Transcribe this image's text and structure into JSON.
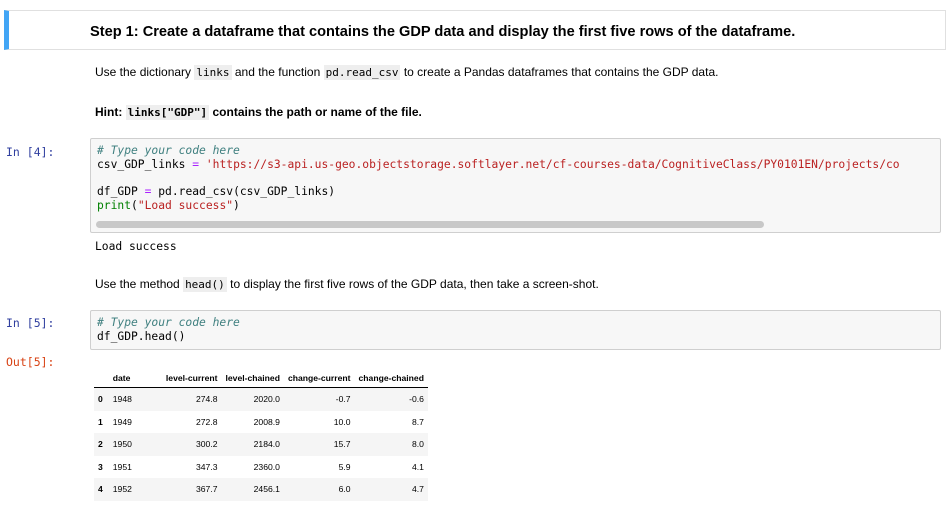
{
  "step": {
    "title": "Step 1: Create a dataframe that contains the GDP data and display the first five rows of the dataframe."
  },
  "instruction1": {
    "before": "Use the dictionary",
    "code1": "links",
    "mid": "and the function",
    "code2": "pd.read_csv",
    "after": "to create a Pandas dataframes that contains the GDP data."
  },
  "hint": {
    "label": "Hint:",
    "code": "links[\"GDP\"]",
    "after": "contains the path or name of the file."
  },
  "cell4": {
    "prompt": "In [4]:",
    "comment": "# Type your code here",
    "line1_var": "csv_GDP_links",
    "line1_op": "=",
    "line1_str": "'https://s3-api.us-geo.objectstorage.softlayer.net/cf-courses-data/CognitiveClass/PY0101EN/projects/co",
    "line2_a": "df_GDP",
    "line2_op": "=",
    "line2_b": "pd.read_csv(csv_GDP_links)",
    "line3_kw": "print",
    "line3_open": "(",
    "line3_str": "\"Load success\"",
    "line3_close": ")",
    "output": "Load success"
  },
  "instruction2": {
    "before": "Use the method",
    "code": "head()",
    "after": "to display the first five rows of the GDP data, then take a screen-shot."
  },
  "cell5": {
    "prompt": "In [5]:",
    "comment": "# Type your code here",
    "line1": "df_GDP.head()",
    "out_prompt": "Out[5]:"
  },
  "table": {
    "columns": [
      "",
      "date",
      "level-current",
      "level-chained",
      "change-current",
      "change-chained"
    ],
    "rows": [
      [
        "0",
        "1948",
        "274.8",
        "2020.0",
        "-0.7",
        "-0.6"
      ],
      [
        "1",
        "1949",
        "272.8",
        "2008.9",
        "10.0",
        "8.7"
      ],
      [
        "2",
        "1950",
        "300.2",
        "2184.0",
        "15.7",
        "8.0"
      ],
      [
        "3",
        "1951",
        "347.3",
        "2360.0",
        "5.9",
        "4.1"
      ],
      [
        "4",
        "1952",
        "367.7",
        "2456.1",
        "6.0",
        "4.7"
      ]
    ]
  }
}
